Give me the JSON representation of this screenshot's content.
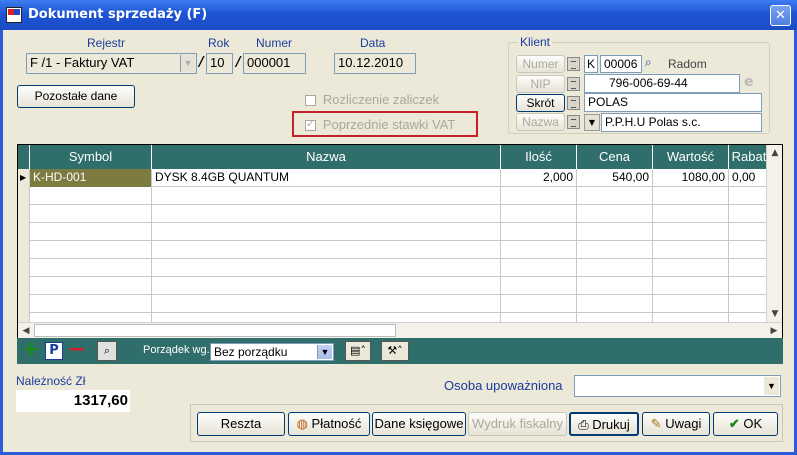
{
  "window": {
    "title": "Dokument sprzedaży (F)",
    "close_glyph": "✕"
  },
  "header": {
    "rejestr_label": "Rejestr",
    "rok_label": "Rok",
    "numer_label": "Numer",
    "data_label": "Data",
    "rejestr_value": "F /1  - Faktury VAT",
    "separator": "/",
    "rok_value": "10",
    "numer_value": "000001",
    "data_value": "10.12.2010",
    "pozostale_button": "Pozostałe dane",
    "rozliczenie_label": "Rozliczenie zaliczek",
    "poprzednie_label": "Poprzednie stawki VAT",
    "poprzednie_checked": true,
    "highlight_color": "#c8202a"
  },
  "client": {
    "group_title": "Klient",
    "numer_label": "Numer",
    "nip_label": "NIP",
    "skrot_label": "Skrót",
    "nazwa_label": "Nazwa",
    "numer_prefix": "K",
    "numer_value": "00006",
    "city": "Radom",
    "nip_value": "796-006-69-44",
    "skrot_value": "POLAS",
    "nazwa_value": "P.P.H.U Polas s.c."
  },
  "grid": {
    "columns": [
      "Symbol",
      "Nazwa",
      "Ilość",
      "Cena",
      "Wartość",
      "Rabat"
    ],
    "rows": [
      {
        "symbol": "K-HD-001",
        "nazwa": "DYSK 8.4GB QUANTUM",
        "ilosc": "2,000",
        "cena": "540,00",
        "wartosc": "1080,00",
        "rabat": "0,00"
      }
    ],
    "header_color": "#2f6e6b"
  },
  "toolbar": {
    "add_glyph": "+",
    "p_glyph": "P",
    "remove_glyph": "−",
    "order_label": "Porządek wg.",
    "order_value": "Bez porządku"
  },
  "footer": {
    "naleznosc_label": "Należność Zł",
    "naleznosc_value": "1317,60",
    "osoba_label": "Osoba upoważniona",
    "osoba_value": "",
    "buttons": {
      "reszta": "Reszta",
      "platnosc": "Płatność",
      "dane_ksiegowe": "Dane księgowe",
      "wydruk_fiskalny": "Wydruk fiskalny",
      "drukuj": "Drukuj",
      "uwagi": "Uwagi",
      "ok": "OK"
    }
  }
}
